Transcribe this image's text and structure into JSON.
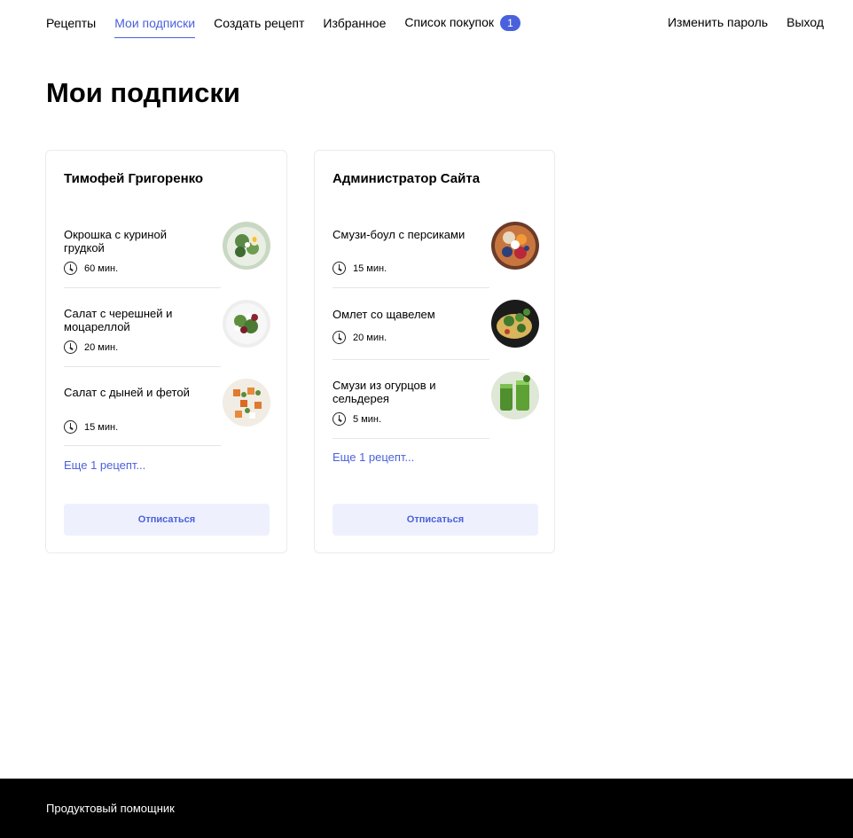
{
  "nav": {
    "left": [
      "Рецепты",
      "Мои подписки",
      "Создать рецепт",
      "Избранное",
      "Список покупок"
    ],
    "active": "Мои подписки",
    "cart_count": "1",
    "right": [
      "Изменить пароль",
      "Выход"
    ],
    "accent_color": "#4a61dd"
  },
  "page": {
    "title": "Мои подписки"
  },
  "subscriptions": [
    {
      "author": "Тимофей Григоренко",
      "recipes": [
        {
          "name": "Окрошка с куриной грудкой",
          "time": "60 мин.",
          "icon": "okroshka-photo"
        },
        {
          "name": "Салат с черешней и моцареллой",
          "time": "20 мин.",
          "icon": "cherry-salad-photo"
        },
        {
          "name": "Салат с дыней и фетой",
          "time": "15 мин.",
          "icon": "melon-salad-photo"
        }
      ],
      "more": "Еще 1 рецепт...",
      "unsubscribe": "Отписаться"
    },
    {
      "author": "Администратор Сайта",
      "recipes": [
        {
          "name": "Смузи-боул с персиками",
          "time": "15 мин.",
          "icon": "smoothie-bowl-photo"
        },
        {
          "name": "Омлет со щавелем",
          "time": "20 мин.",
          "icon": "omelette-photo"
        },
        {
          "name": "Смузи из огурцов и сельдерея",
          "time": "5 мин.",
          "icon": "green-smoothie-photo"
        }
      ],
      "more": "Еще 1 рецепт...",
      "unsubscribe": "Отписаться"
    }
  ],
  "footer": {
    "text": "Продуктовый помощник"
  }
}
